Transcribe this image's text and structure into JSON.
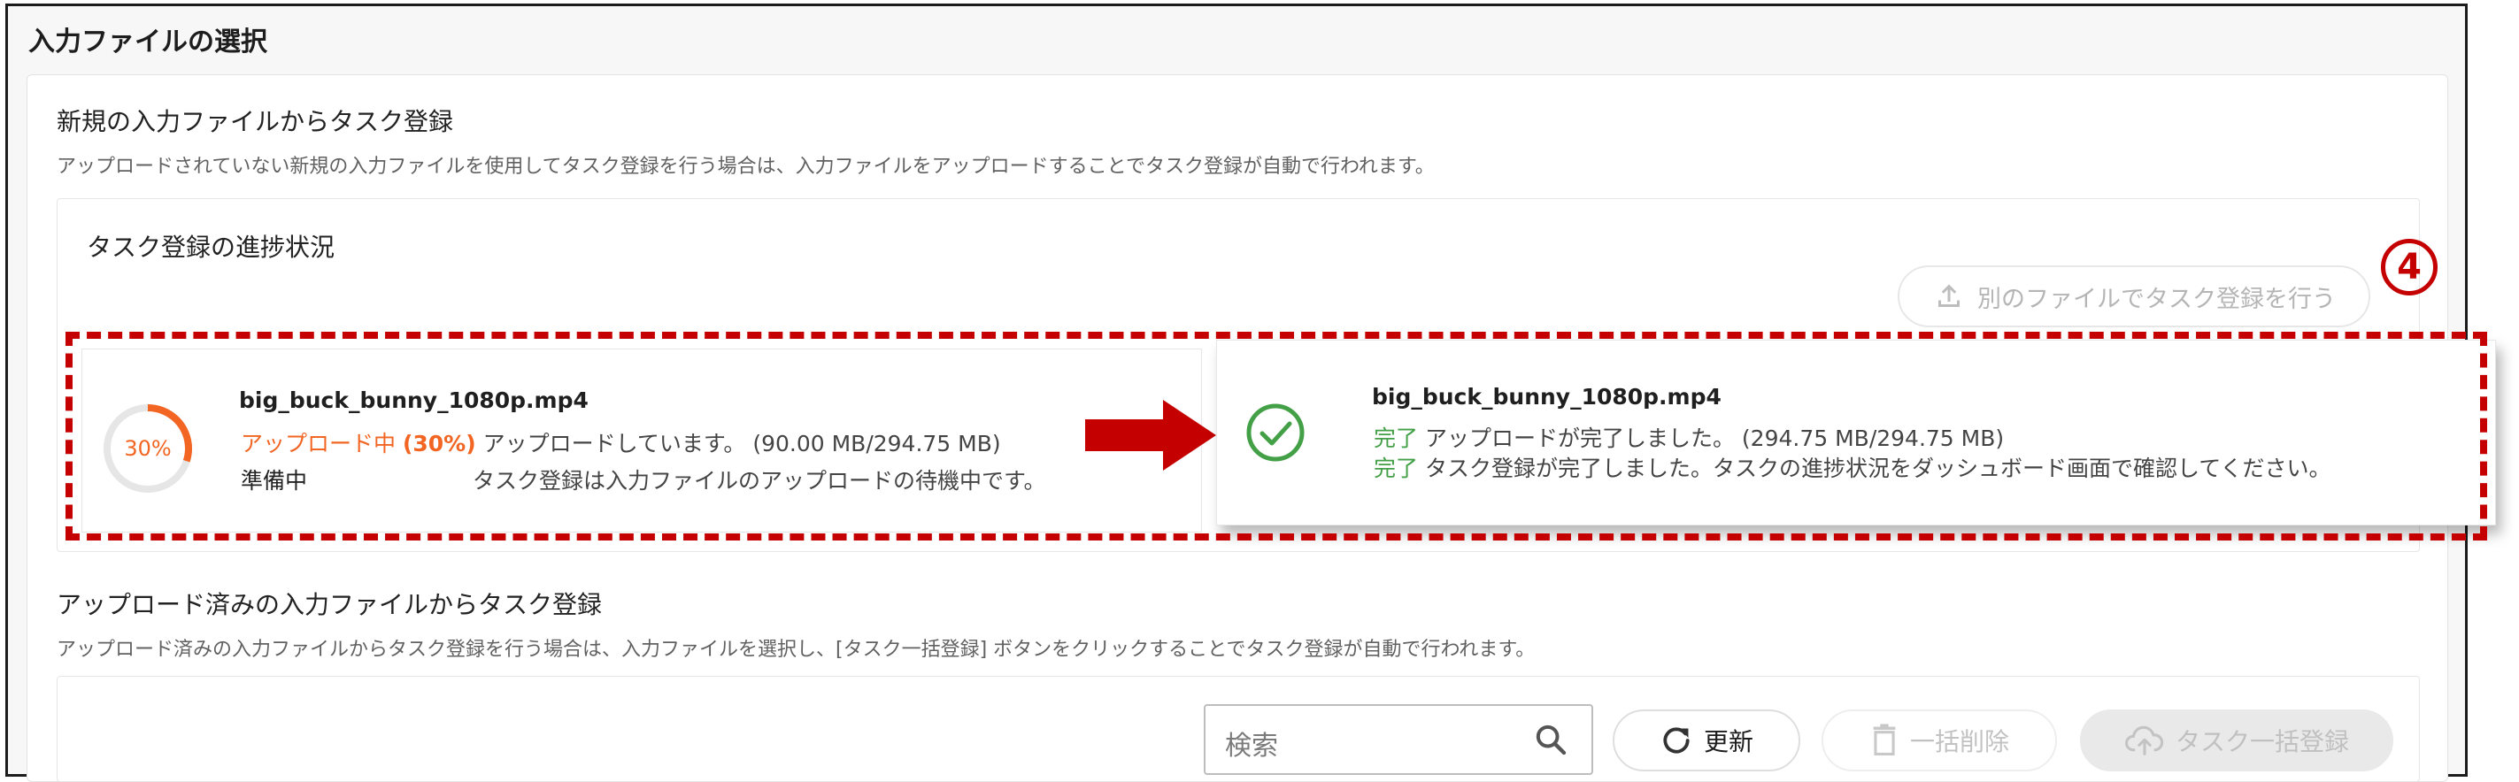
{
  "page_title": "入力ファイルの選択",
  "new_section": {
    "title": "新規の入力ファイルからタスク登録",
    "description": "アップロードされていない新規の入力ファイルを使用してタスク登録を行う場合は、入力ファイルをアップロードすることでタスク登録が自動で行われます。"
  },
  "progress": {
    "title": "タスク登録の進捗状況",
    "alt_button_label": "別のファイルでタスク登録を行う",
    "annotation_number": "4",
    "before": {
      "percent_label": "30%",
      "percent": 30,
      "file_name": "big_buck_bunny_1080p.mp4",
      "status1_label": "アップロード中",
      "status1_pct": "(30%)",
      "status1_text": "アップロードしています。 (90.00 MB/294.75 MB)",
      "status2_label": "準備中",
      "status2_text": "タスク登録は入力ファイルのアップロードの待機中です。"
    },
    "after": {
      "file_name": "big_buck_bunny_1080p.mp4",
      "status1_label": "完了",
      "status1_text": "アップロードが完了しました。 (294.75 MB/294.75 MB)",
      "status2_label": "完了",
      "status2_text": "タスク登録が完了しました。タスクの進捗状況をダッシュボード画面で確認してください。"
    }
  },
  "uploaded_section": {
    "title": "アップロード済みの入力ファイルからタスク登録",
    "description": "アップロード済みの入力ファイルからタスク登録を行う場合は、入力ファイルを選択し、[タスク一括登録] ボタンをクリックすることでタスク登録が自動で行われます。"
  },
  "toolbar": {
    "search_placeholder": "検索",
    "refresh_label": "更新",
    "bulk_delete_label": "一括削除",
    "bulk_register_label": "タスク一括登録"
  },
  "colors": {
    "accent_orange": "#f26522",
    "success_green": "#43a047",
    "annotation_red": "#c40000"
  },
  "icons": [
    "upload-icon",
    "check-circle-icon",
    "right-arrow-icon",
    "search-icon",
    "refresh-icon",
    "trash-icon",
    "cloud-upload-icon"
  ]
}
